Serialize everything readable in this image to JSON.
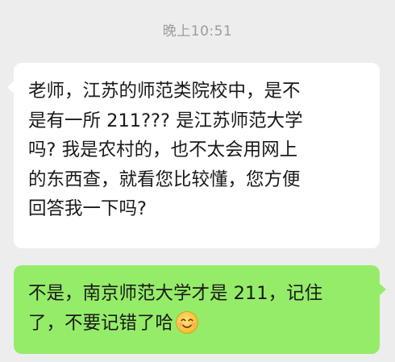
{
  "chat": {
    "timestamp": "晚上10:51",
    "received_message": {
      "lines": [
        "老师，江苏的师范类院校中，是不",
        "是有一所 211??? 是江苏师范大学",
        "吗? 我是农村的，也不太会用网上",
        "的东西查，就看您比较懂，您方便",
        "回答我一下吗?"
      ]
    },
    "sent_message": {
      "lines": [
        "不是，南京师范大学才是 211，记住",
        "了，不要记错了哈"
      ],
      "emoji": "smiling-face-emoji"
    }
  },
  "colors": {
    "background": "#ededed",
    "received_bubble": "#ffffff",
    "sent_bubble": "#95ec69",
    "timestamp_text": "#9c9c9c",
    "message_text": "#1a1a1a"
  }
}
